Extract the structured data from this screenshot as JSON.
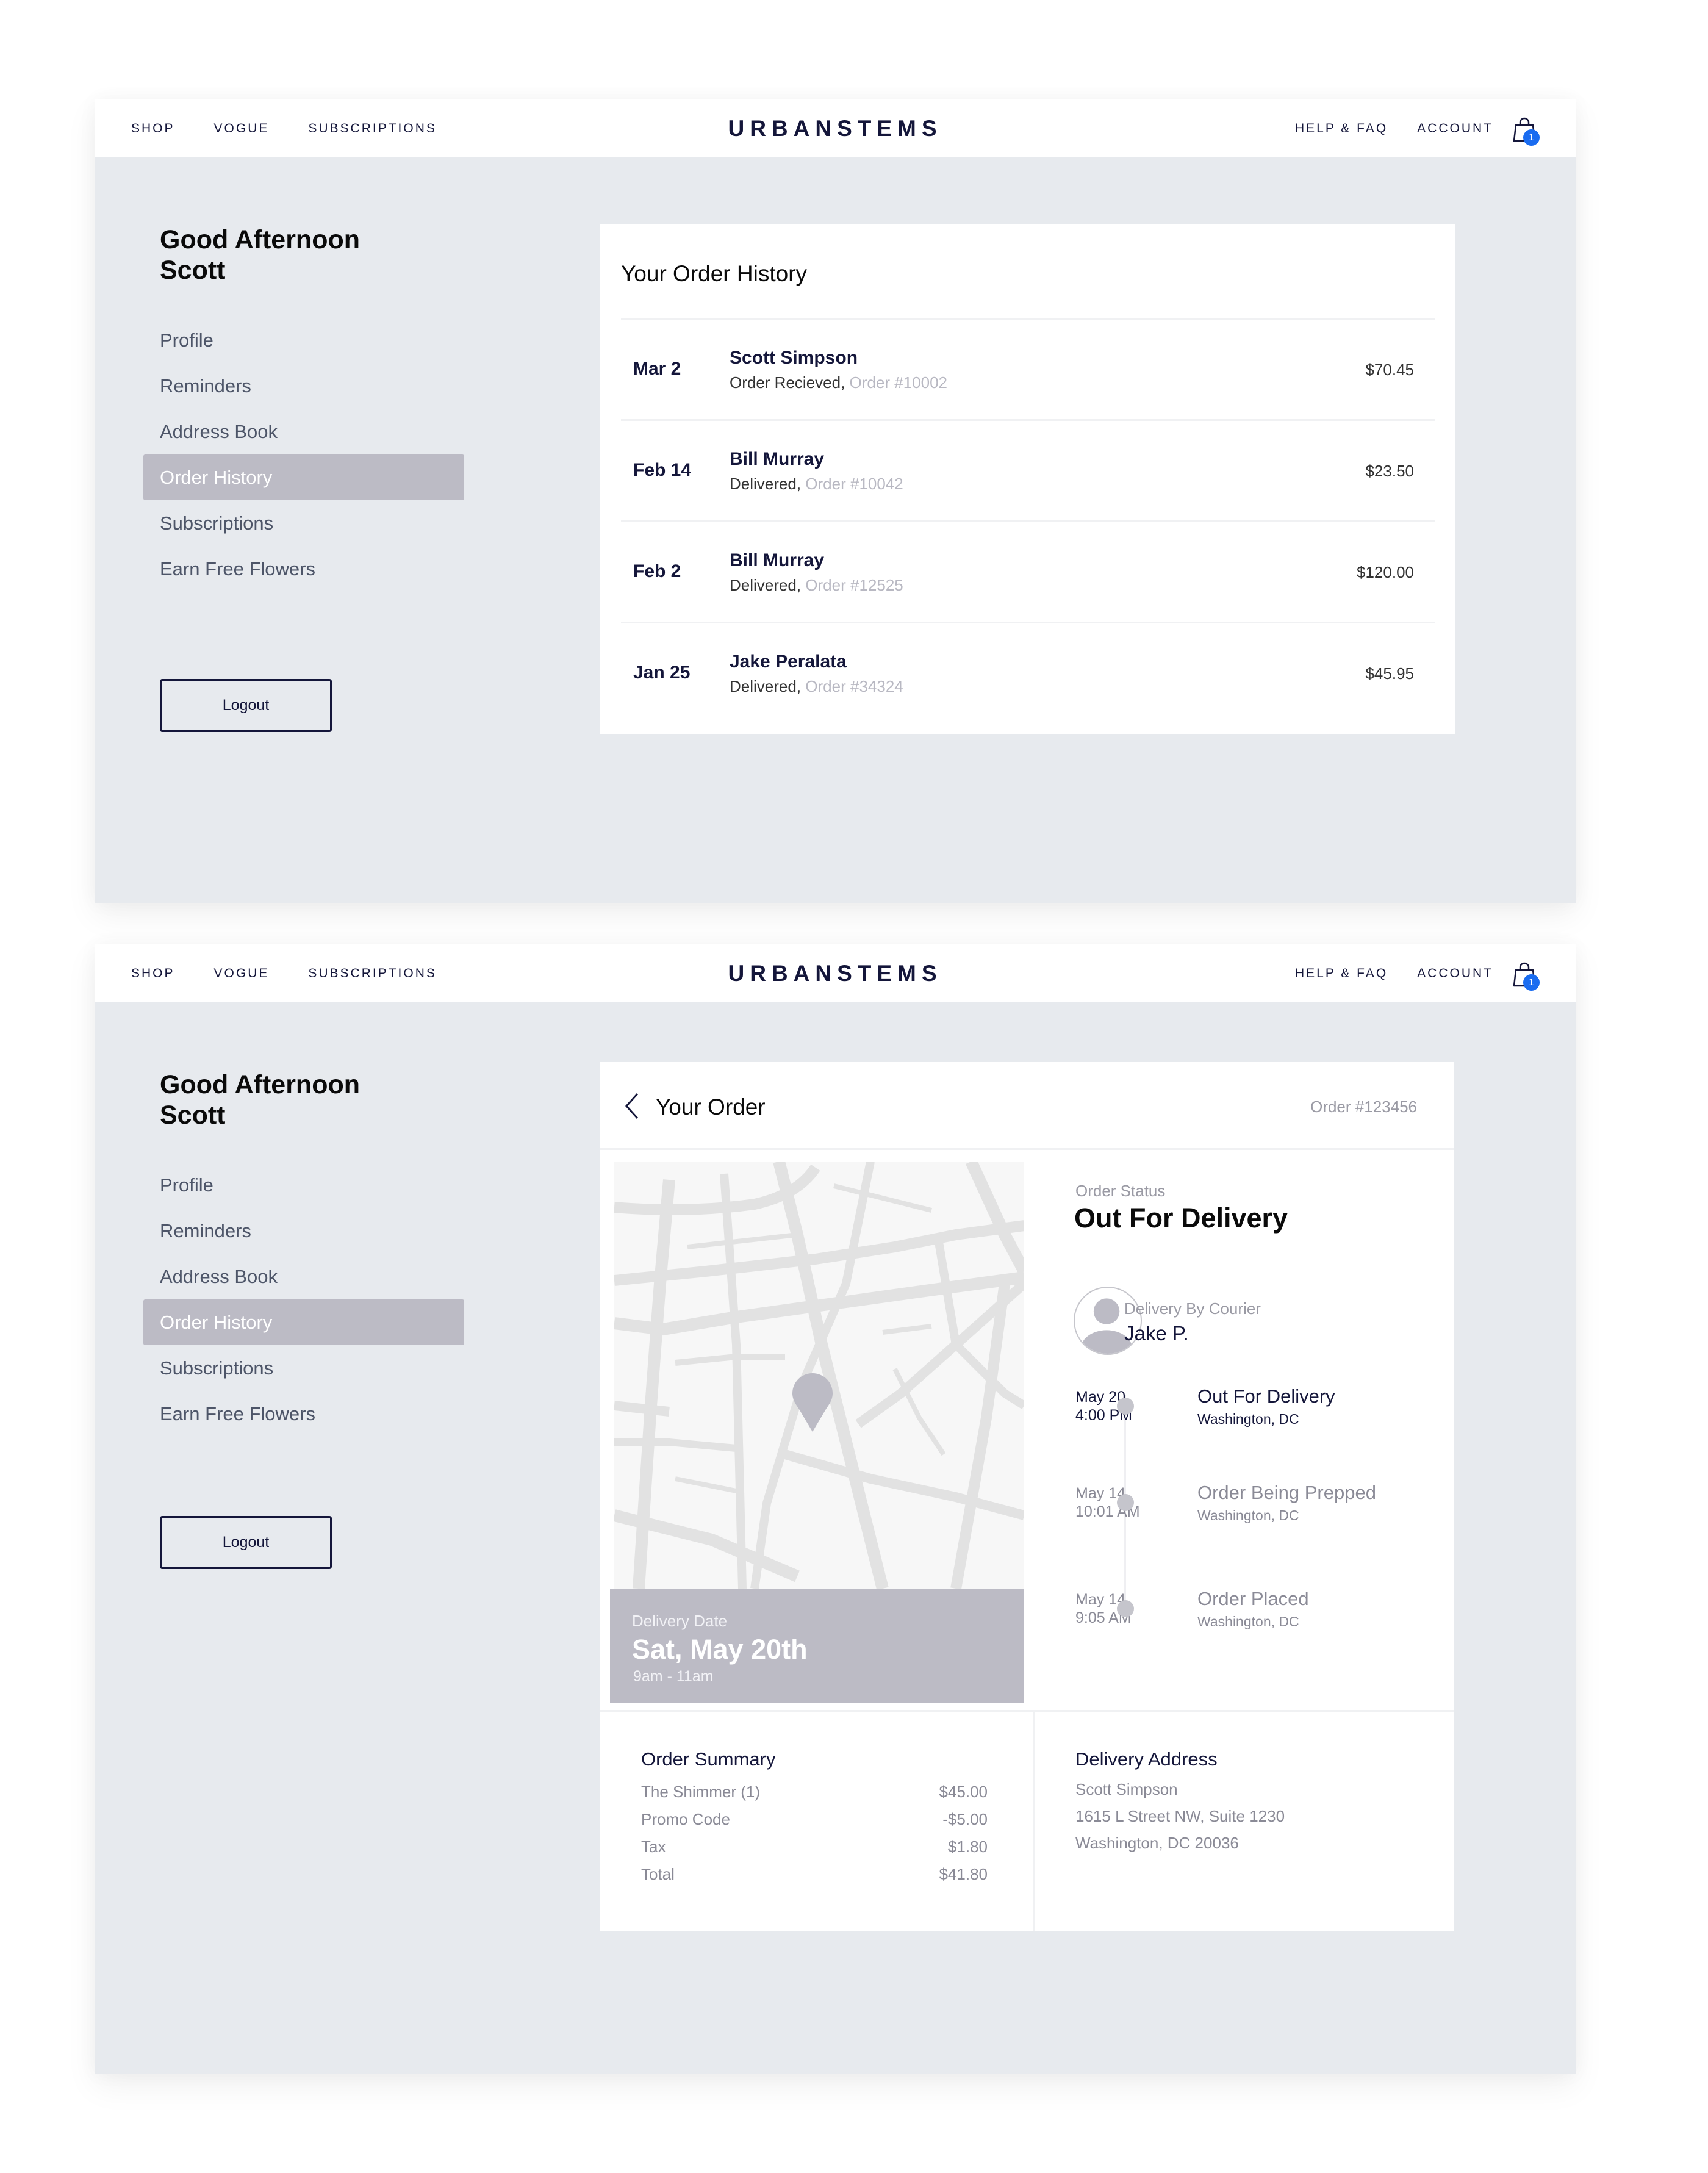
{
  "colors": {
    "brand_navy": "#14163a",
    "panel_bg": "#e7eaee",
    "active_item": "#bcbbc5",
    "badge_blue": "#1a6cf0",
    "muted_text": "#8a8a96"
  },
  "nav": {
    "left_links": [
      "SHOP",
      "VOGUE",
      "SUBSCRIPTIONS"
    ],
    "logo": "URBANSTEMS",
    "right_links": [
      "HELP & FAQ",
      "ACCOUNT"
    ],
    "cart_icon": "shopping-bag-icon",
    "cart_count": "1"
  },
  "sidebar": {
    "greeting_line1": "Good Afternoon",
    "greeting_line2": "Scott",
    "items": [
      {
        "label": "Profile",
        "active": false
      },
      {
        "label": "Reminders",
        "active": false
      },
      {
        "label": "Address Book",
        "active": false
      },
      {
        "label": "Order History",
        "active": true
      },
      {
        "label": "Subscriptions",
        "active": false
      },
      {
        "label": "Earn Free Flowers",
        "active": false
      }
    ],
    "logout_label": "Logout"
  },
  "order_history": {
    "title": "Your Order History",
    "orders": [
      {
        "date": "Mar 2",
        "name": "Scott Simpson",
        "status": "Order Recieved,",
        "order_number": "Order #10002",
        "price": "$70.45"
      },
      {
        "date": "Feb 14",
        "name": "Bill Murray",
        "status": "Delivered,",
        "order_number": "Order #10042",
        "price": "$23.50"
      },
      {
        "date": "Feb 2",
        "name": "Bill Murray",
        "status": "Delivered,",
        "order_number": "Order #12525",
        "price": "$120.00"
      },
      {
        "date": "Jan 25",
        "name": "Jake Peralata",
        "status": "Delivered,",
        "order_number": "Order #34324",
        "price": "$45.95"
      }
    ]
  },
  "order_detail": {
    "title": "Your Order",
    "order_number": "Order #123456",
    "map_pin_icon": "map-pin-icon",
    "delivery": {
      "label": "Delivery Date",
      "date": "Sat, May 20th",
      "window": "9am - 11am"
    },
    "status": {
      "label": "Order Status",
      "value": "Out For Delivery"
    },
    "courier": {
      "label": "Delivery By Courier",
      "name": "Jake P."
    },
    "timeline": [
      {
        "date": "May 20",
        "time": "4:00 PM",
        "title": "Out For Delivery",
        "location": "Washington, DC",
        "current": true
      },
      {
        "date": "May 14",
        "time": "10:01 AM",
        "title": "Order Being Prepped",
        "location": "Washington, DC",
        "current": false
      },
      {
        "date": "May 14",
        "time": "9:05 AM",
        "title": "Order Placed",
        "location": "Washington, DC",
        "current": false
      }
    ],
    "summary": {
      "title": "Order Summary",
      "rows": [
        {
          "label": "The Shimmer (1)",
          "value": "$45.00"
        },
        {
          "label": "Promo Code",
          "value": "-$5.00"
        },
        {
          "label": "Tax",
          "value": "$1.80"
        },
        {
          "label": "Total",
          "value": "$41.80"
        }
      ]
    },
    "address": {
      "title": "Delivery Address",
      "lines": [
        "Scott Simpson",
        "1615 L Street NW, Suite 1230",
        "Washington, DC 20036"
      ]
    }
  }
}
